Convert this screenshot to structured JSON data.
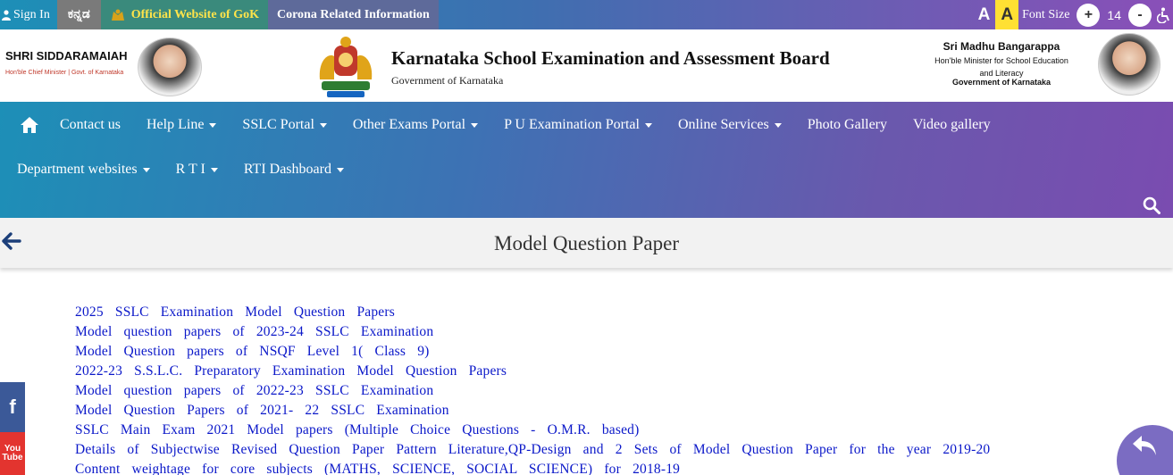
{
  "topbar": {
    "sign_in": "Sign In",
    "kannada": "ಕನ್ನಡ",
    "official_site": "Official Website of GoK",
    "corona": "Corona Related Information",
    "font_small": "A",
    "font_large": "A",
    "font_size_label": "Font Size",
    "font_plus": "+",
    "font_value": "14",
    "font_minus": "-"
  },
  "header": {
    "cm_name": "SHRI SIDDARAMAIAH",
    "cm_title": "Hon'ble Chief Minister | Govt. of Karnataka",
    "board_title": "Karnataka School Examination and Assessment Board",
    "board_subtitle": "Government of Karnataka",
    "minister_name": "Sri Madhu Bangarappa",
    "minister_title_1": "Hon'ble Minister for School Education",
    "minister_title_2": "and Literacy",
    "minister_title_3": "Government of Karnataka"
  },
  "nav": {
    "row1": [
      {
        "label": "Contact us",
        "dropdown": false
      },
      {
        "label": "Help Line",
        "dropdown": true
      },
      {
        "label": "SSLC Portal",
        "dropdown": true
      },
      {
        "label": "Other Exams Portal",
        "dropdown": true
      },
      {
        "label": "P U Examination Portal",
        "dropdown": true
      },
      {
        "label": "Online Services",
        "dropdown": true
      },
      {
        "label": "Photo Gallery",
        "dropdown": false
      },
      {
        "label": "Video gallery",
        "dropdown": false
      }
    ],
    "row2": [
      {
        "label": "Department websites",
        "dropdown": true
      },
      {
        "label": "R T I",
        "dropdown": true
      },
      {
        "label": "RTI Dashboard",
        "dropdown": true
      }
    ]
  },
  "page": {
    "title": "Model Question Paper"
  },
  "papers": [
    "2025 SSLC Examination Model Question Papers",
    "Model question papers of 2023-24 SSLC Examination",
    "Model Question papers of NSQF Level 1( Class 9)",
    "2022-23 S.S.L.C. Preparatory Examination Model Question Papers",
    "Model question papers of 2022-23 SSLC Examination",
    "Model Question Papers of 2021- 22 SSLC Examination",
    "SSLC Main Exam 2021 Model papers (Multiple Choice Questions - O.M.R. based)",
    "Details of Subjectwise Revised Question Paper Pattern Literature,QP-Design and 2 Sets of Model Question Paper for the year 2019-20",
    "Content weightage for core subjects (MATHS, SCIENCE, SOCIAL SCIENCE) for 2018-19"
  ],
  "social": {
    "facebook": "f",
    "youtube_1": "You",
    "youtube_2": "Tube"
  }
}
